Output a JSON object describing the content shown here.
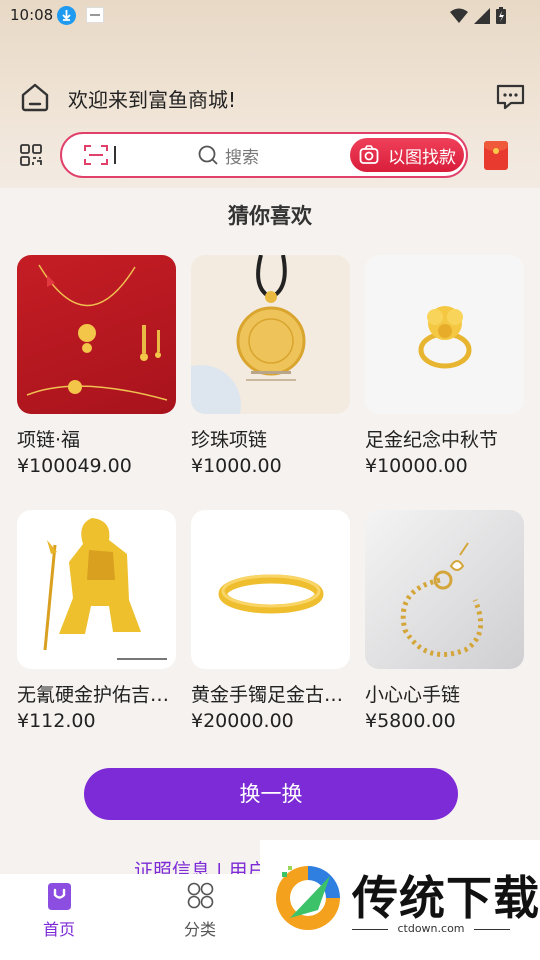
{
  "status_bar": {
    "time": "10:08"
  },
  "header": {
    "welcome": "欢迎来到富鱼商城!"
  },
  "search": {
    "placeholder": "搜索",
    "image_search_label": "以图找款"
  },
  "section_title": "猜你喜欢",
  "products": [
    {
      "name": "项链·福",
      "price": "¥100049.00",
      "image": "red-gold-necklace"
    },
    {
      "name": "珍珠项链",
      "price": "¥1000.00",
      "image": "gold-pendant-bagua"
    },
    {
      "name": "足金纪念中秋节",
      "price": "¥10000.00",
      "image": "gold-flower-ring"
    },
    {
      "name": "无氰硬金护佑吉…",
      "price": "¥112.00",
      "image": "gold-guanyu-statue"
    },
    {
      "name": "黄金手镯足金古…",
      "price": "¥20000.00",
      "image": "gold-bangle"
    },
    {
      "name": "小心心手链",
      "price": "¥5800.00",
      "image": "gold-bead-bracelet"
    }
  ],
  "swap_button": "换一换",
  "footer_link": "证照信息 | 用户",
  "tabbar": {
    "items": [
      {
        "label": "首页",
        "icon": "shopping-bag-icon",
        "active": true
      },
      {
        "label": "分类",
        "icon": "category-icon",
        "active": false
      }
    ]
  },
  "watermark": {
    "title": "传统下载",
    "url": "ctdown.com"
  },
  "colors": {
    "accent": "#7c2bd6",
    "search_border": "#e0406a",
    "image_search_bg": "#e02a45"
  }
}
